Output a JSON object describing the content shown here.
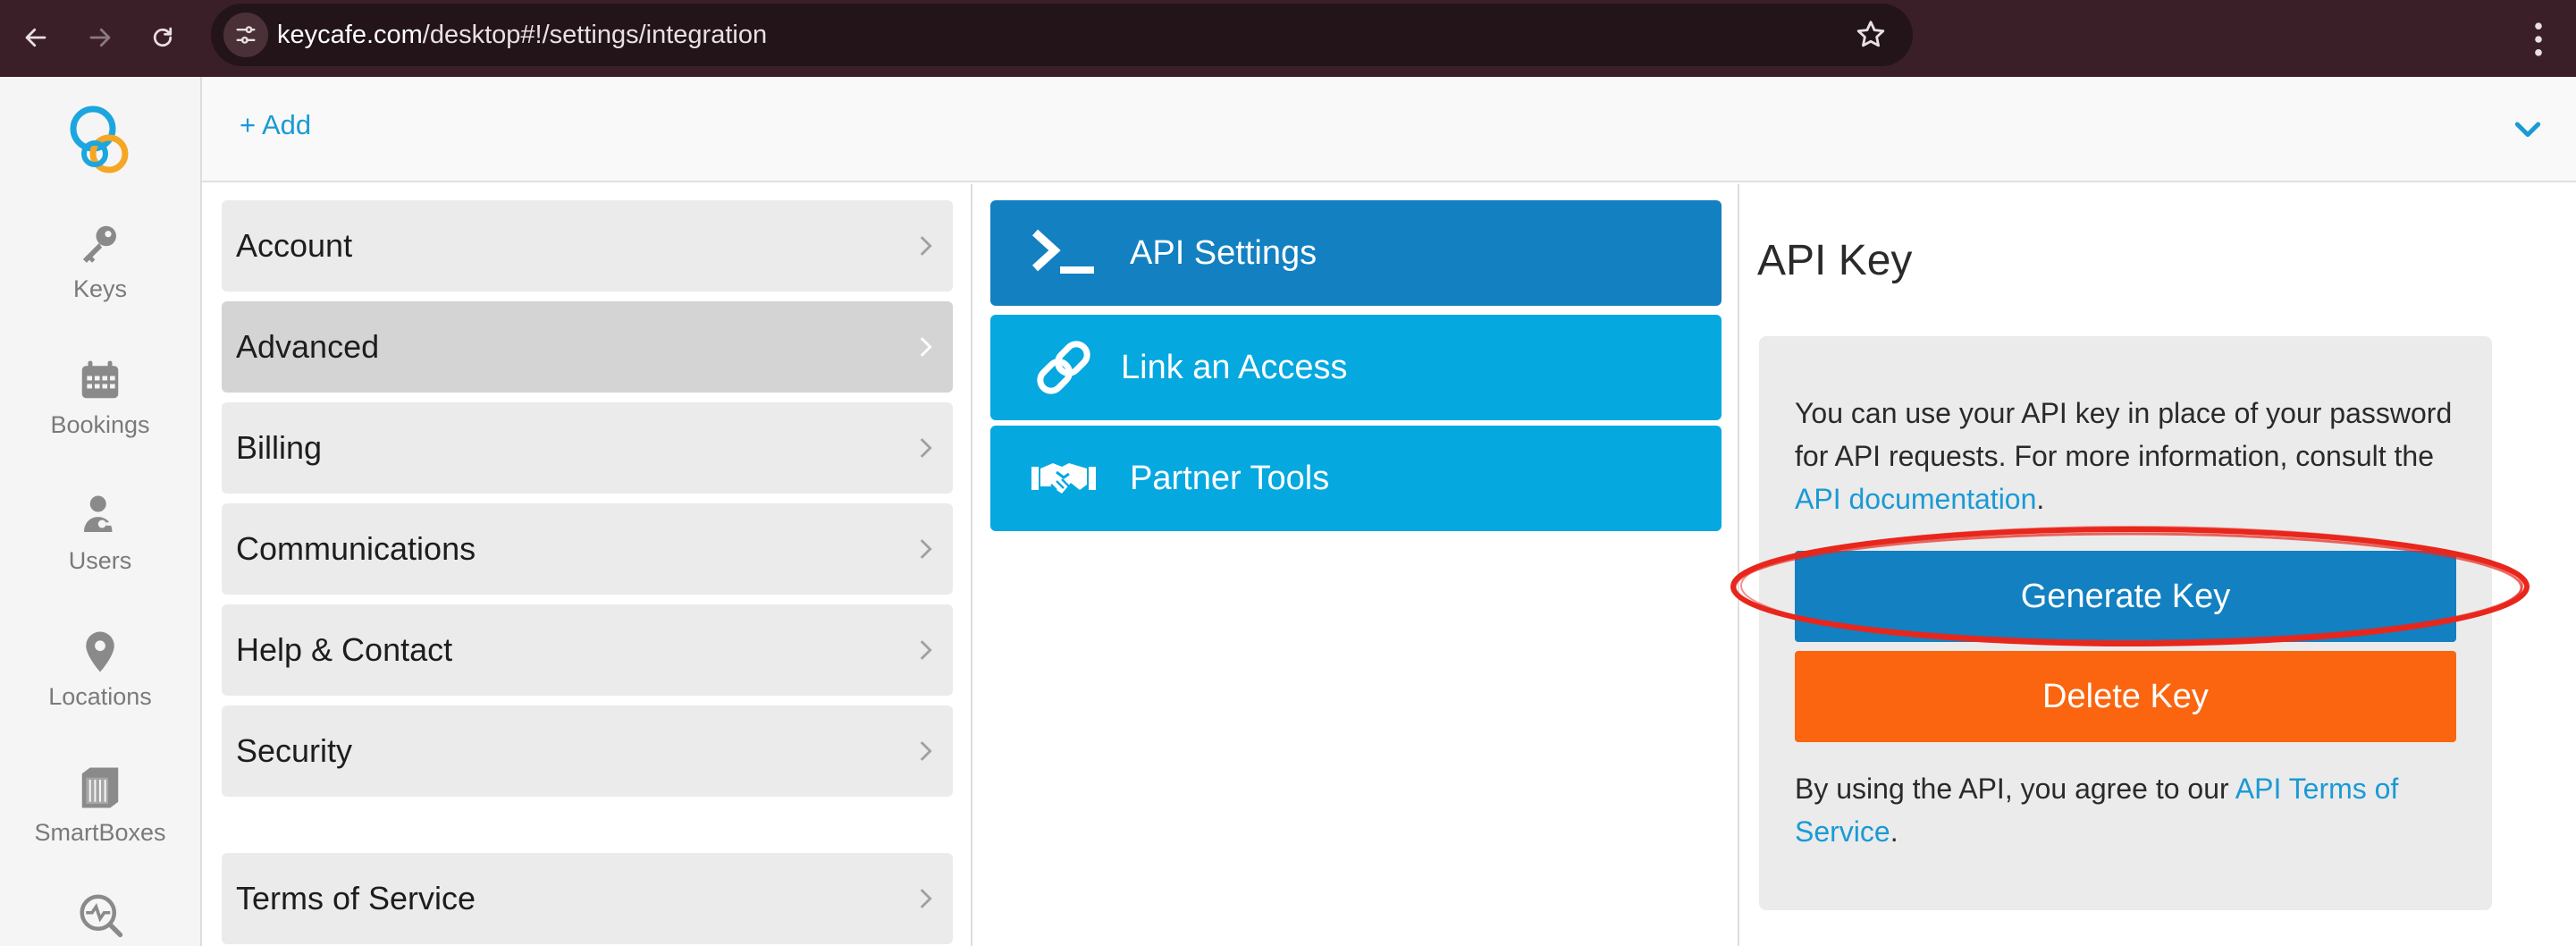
{
  "browser": {
    "url_domain": "keycafe.com",
    "url_path": "/desktop#!/settings/integration"
  },
  "rail": {
    "items": [
      {
        "label": "Keys",
        "icon": "key-icon"
      },
      {
        "label": "Bookings",
        "icon": "calendar-icon"
      },
      {
        "label": "Users",
        "icon": "users-icon"
      },
      {
        "label": "Locations",
        "icon": "location-pin-icon"
      },
      {
        "label": "SmartBoxes",
        "icon": "smartbox-icon"
      },
      {
        "label": "",
        "icon": "monitoring-icon"
      }
    ]
  },
  "topbar": {
    "add_label": "+ Add"
  },
  "settings_menu": {
    "items": [
      {
        "label": "Account",
        "active": false
      },
      {
        "label": "Advanced",
        "active": true
      },
      {
        "label": "Billing",
        "active": false
      },
      {
        "label": "Communications",
        "active": false
      },
      {
        "label": "Help & Contact",
        "active": false
      },
      {
        "label": "Security",
        "active": false
      },
      {
        "label": "Terms of Service",
        "active": false
      }
    ]
  },
  "integration": {
    "items": [
      {
        "label": "API Settings",
        "icon": "terminal-icon",
        "selected": true
      },
      {
        "label": "Link an Access",
        "icon": "link-icon",
        "selected": false
      },
      {
        "label": "Partner Tools",
        "icon": "handshake-icon",
        "selected": false
      }
    ]
  },
  "api_key": {
    "title": "API Key",
    "description_prefix": "You can use your API key in place of your password for API requests. For more information, consult the ",
    "description_link": "API documentation",
    "description_suffix": ".",
    "generate_label": "Generate Key",
    "delete_label": "Delete Key",
    "terms_prefix": "By using the API, you agree to our ",
    "terms_link": "API Terms of Service",
    "terms_suffix": "."
  },
  "colors": {
    "primary_blue": "#1380c1",
    "light_blue": "#06a8e0",
    "orange": "#fb6510",
    "annotation_red": "#e8261c"
  }
}
